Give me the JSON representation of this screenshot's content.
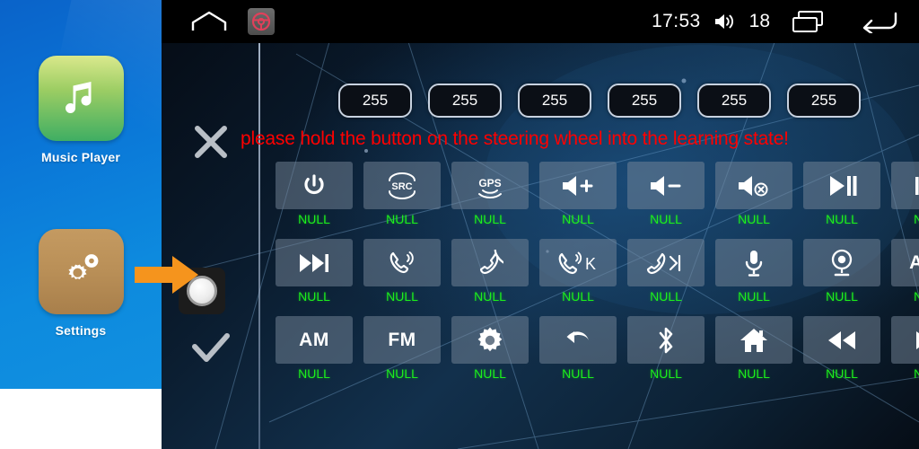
{
  "statusbar": {
    "home_icon": "home-outline-icon",
    "app_icon": "steering-wheel-icon",
    "clock": "17:53",
    "volume_icon": "volume-waves-icon",
    "volume_value": "18",
    "recents_icon": "recent-apps-icon",
    "back_icon": "back-arrow-icon"
  },
  "sidebar": {
    "apps": [
      {
        "label": "Music Player",
        "icon": "music-note-icon"
      },
      {
        "label": "Settings",
        "icon": "gears-icon"
      }
    ]
  },
  "annotation": {
    "arrow_icon": "orange-pointer-arrow",
    "color": "#F5941D"
  },
  "controls": {
    "cancel": {
      "icon": "x-icon",
      "label": "cancel"
    },
    "record": {
      "icon": "record-knob-icon",
      "label": "record"
    },
    "confirm": {
      "icon": "check-icon",
      "label": "confirm"
    }
  },
  "chips": [
    {
      "value": "255"
    },
    {
      "value": "255"
    },
    {
      "value": "255"
    },
    {
      "value": "255"
    },
    {
      "value": "255"
    },
    {
      "value": "255"
    }
  ],
  "warning": {
    "text": "please hold the button on the steering wheel into the learning state!",
    "color": "#FF0000"
  },
  "grid": {
    "null_label": "NULL",
    "label_color": "#1CF01C",
    "rows": [
      [
        {
          "icon": "power-icon",
          "text": "",
          "label": "NULL"
        },
        {
          "icon": "src-icon",
          "text": "SRC",
          "label": "NULL"
        },
        {
          "icon": "gps-icon",
          "text": "GPS",
          "label": "NULL"
        },
        {
          "icon": "volume-up-icon",
          "text": "",
          "label": "NULL"
        },
        {
          "icon": "volume-down-icon",
          "text": "",
          "label": "NULL"
        },
        {
          "icon": "volume-mute-icon",
          "text": "",
          "label": "NULL"
        },
        {
          "icon": "play-pause-icon",
          "text": "",
          "label": "NULL"
        },
        {
          "icon": "previous-track-icon",
          "text": "",
          "label": "NULL"
        }
      ],
      [
        {
          "icon": "next-track-icon",
          "text": "",
          "label": "NULL"
        },
        {
          "icon": "phone-answer-icon",
          "text": "",
          "label": "NULL"
        },
        {
          "icon": "phone-hangup-icon",
          "text": "",
          "label": "NULL"
        },
        {
          "icon": "phone-answer-k-icon",
          "text": "K",
          "label": "NULL"
        },
        {
          "icon": "phone-hangup-next-icon",
          "text": "",
          "label": "NULL"
        },
        {
          "icon": "microphone-icon",
          "text": "",
          "label": "NULL"
        },
        {
          "icon": "camera-icon",
          "text": "",
          "label": "NULL"
        },
        {
          "icon": "aux-icon",
          "text": "AUX",
          "label": "NULL"
        }
      ],
      [
        {
          "icon": "am-icon",
          "text": "AM",
          "label": "NULL"
        },
        {
          "icon": "fm-icon",
          "text": "FM",
          "label": "NULL"
        },
        {
          "icon": "brightness-gear-icon",
          "text": "",
          "label": "NULL"
        },
        {
          "icon": "back-curved-arrow-icon",
          "text": "",
          "label": "NULL"
        },
        {
          "icon": "bluetooth-icon",
          "text": "",
          "label": "NULL"
        },
        {
          "icon": "home-solid-icon",
          "text": "",
          "label": "NULL"
        },
        {
          "icon": "rewind-icon",
          "text": "",
          "label": "NULL"
        },
        {
          "icon": "fast-forward-icon",
          "text": "",
          "label": "NULL"
        }
      ]
    ]
  }
}
